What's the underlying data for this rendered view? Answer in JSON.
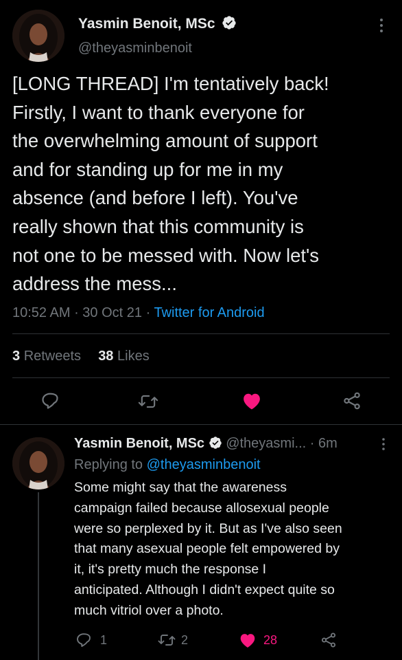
{
  "main_tweet": {
    "author_name": "Yasmin Benoit, MSc",
    "handle": "@theyasminbenoit",
    "text": "[LONG THREAD] I'm tentatively back!\nFirstly, I want to thank everyone for\nthe overwhelming amount of support\nand for standing up for me in my\nabsence (and before I left). You've\nreally shown that this community is\nnot one to be messed with. Now let's\naddress the mess...",
    "time": "10:52 AM",
    "date": "30 Oct 21",
    "source": "Twitter for Android",
    "retweets_count": "3",
    "retweets_label": "Retweets",
    "likes_count": "38",
    "likes_label": "Likes"
  },
  "reply_tweet": {
    "author_name": "Yasmin Benoit, MSc",
    "handle": "@theyasmi...",
    "age": "6m",
    "replying_prefix": "Replying to",
    "replying_handle": "@theyasminbenoit",
    "text": "Some might say that the awareness\ncampaign failed because allosexual people\nwere so perplexed by it. But as I've also seen\nthat many asexual people felt empowered by\nit, it's pretty much the response I\nanticipated. Although I didn't expect quite so\nmuch vitriol over a photo.",
    "reply_count": "1",
    "retweet_count": "2",
    "like_count": "28"
  },
  "colors": {
    "background": "#000000",
    "text": "#e7e9ea",
    "muted": "#71767b",
    "link": "#1d9bf0",
    "like": "#f91880",
    "divider": "#2f3336"
  },
  "icons": [
    "more-icon",
    "verified-icon",
    "reply-icon",
    "retweet-icon",
    "heart-icon",
    "share-icon"
  ]
}
